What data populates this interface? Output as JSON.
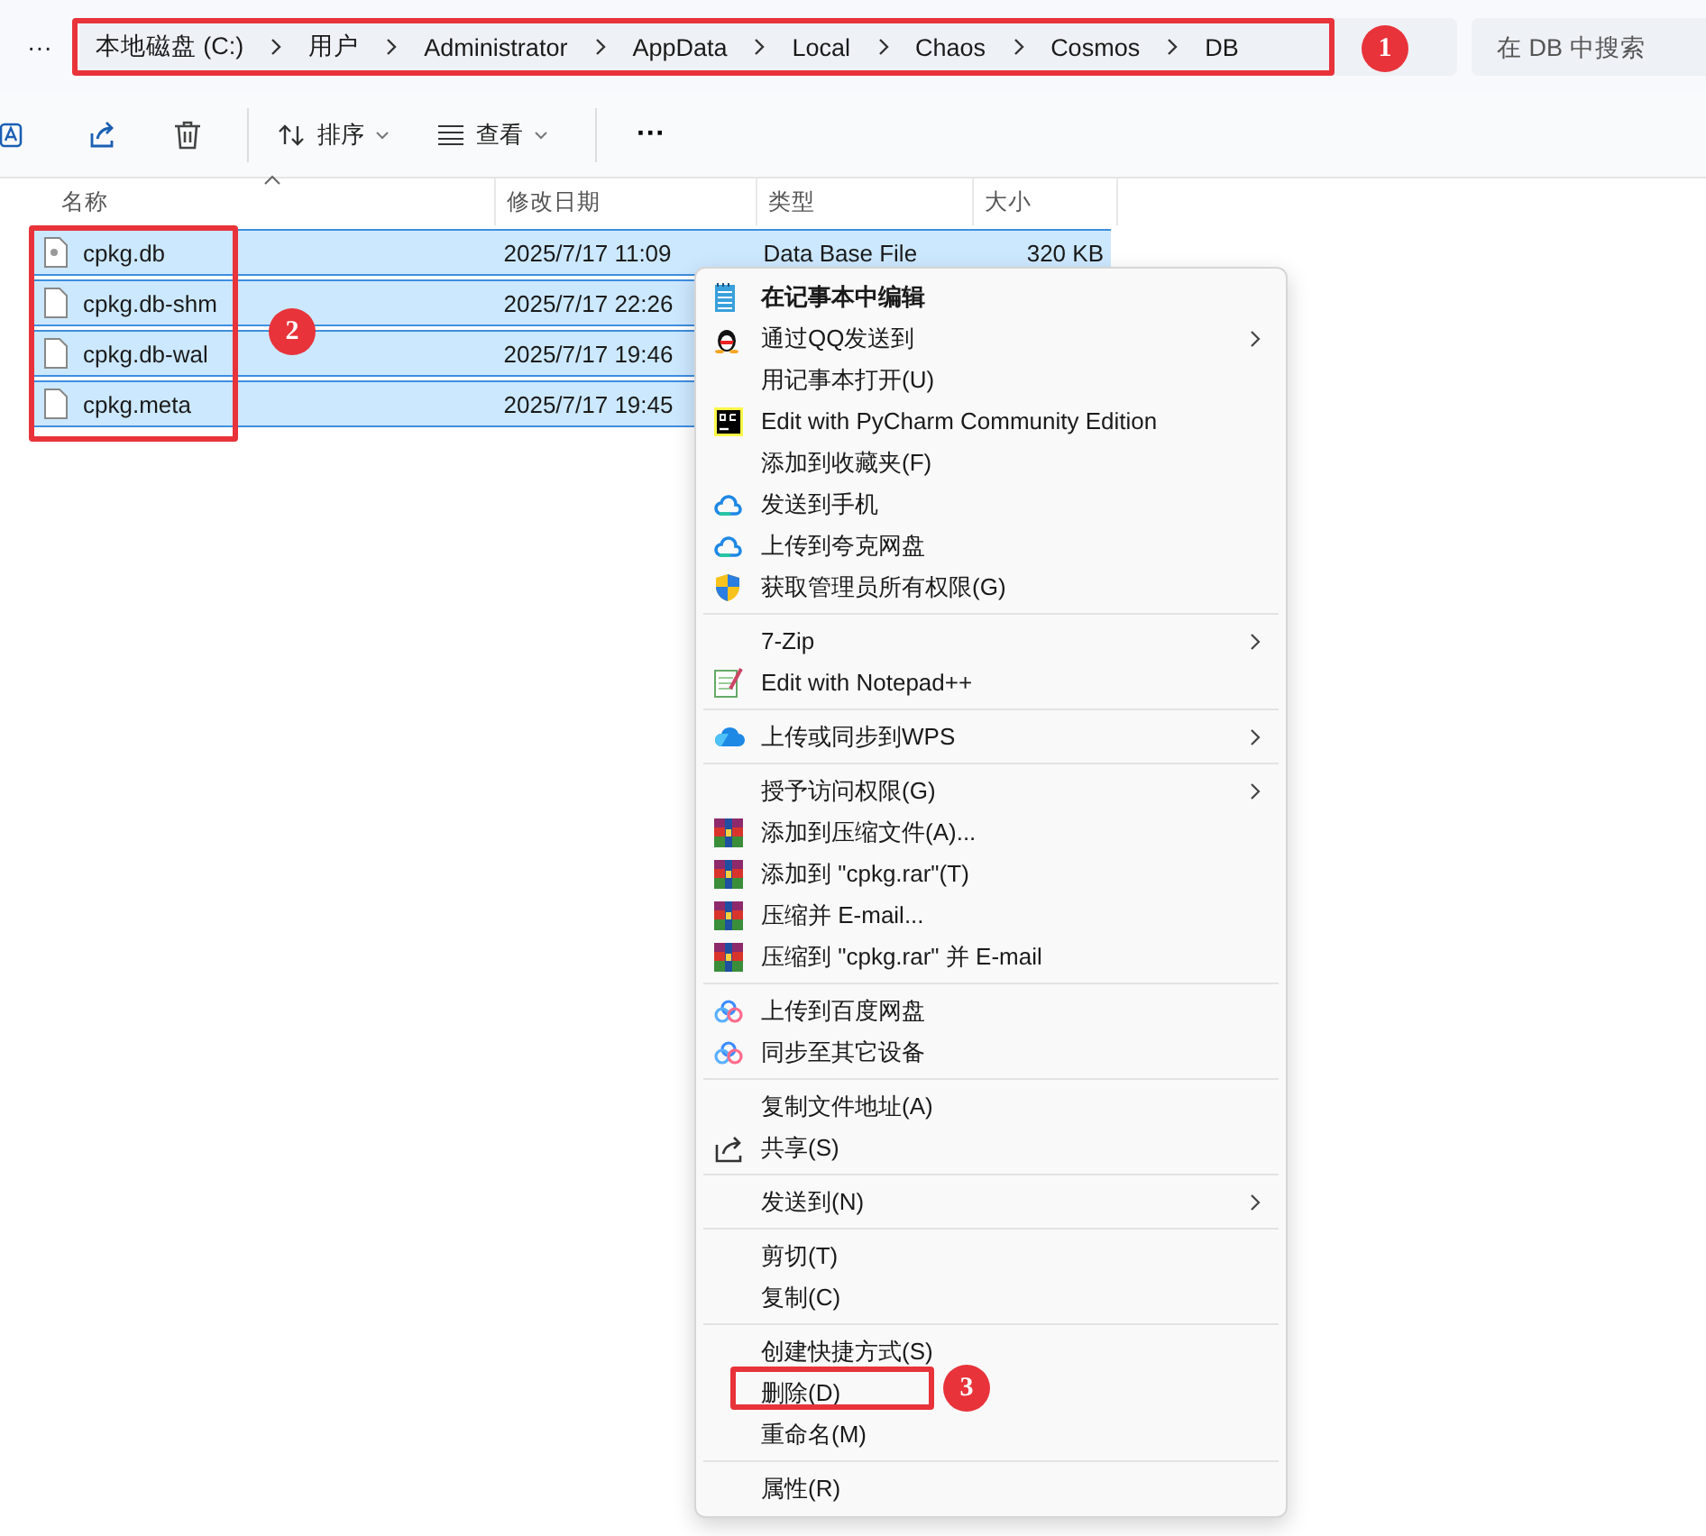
{
  "address_bar": {
    "more": "···",
    "breadcrumbs": [
      "本地磁盘 (C:)",
      "用户",
      "Administrator",
      "AppData",
      "Local",
      "Chaos",
      "Cosmos",
      "DB"
    ]
  },
  "search": {
    "placeholder": "在 DB 中搜索"
  },
  "toolbar": {
    "sort": "排序",
    "view": "查看",
    "more": "···"
  },
  "table": {
    "columns": [
      "名称",
      "修改日期",
      "类型",
      "大小"
    ],
    "rows": [
      {
        "name": "cpkg.db",
        "modified": "2025/7/17 11:09",
        "type": "Data Base File",
        "size": "320 KB",
        "selected": true
      },
      {
        "name": "cpkg.db-shm",
        "modified": "2025/7/17 22:26",
        "selected": true
      },
      {
        "name": "cpkg.db-wal",
        "modified": "2025/7/17 19:46",
        "selected": true
      },
      {
        "name": "cpkg.meta",
        "modified": "2025/7/17 19:45",
        "selected": true
      }
    ]
  },
  "context_menu": {
    "groups": [
      {
        "items": [
          {
            "label": "在记事本中编辑",
            "default": true,
            "submenu": false
          },
          {
            "label": "通过QQ发送到",
            "default": false,
            "submenu": true
          },
          {
            "label": "用记事本打开(U)",
            "default": false,
            "submenu": false
          },
          {
            "label": "Edit with PyCharm Community Edition",
            "default": false,
            "submenu": false
          },
          {
            "label": "添加到收藏夹(F)",
            "default": false,
            "submenu": false
          },
          {
            "label": "发送到手机",
            "default": false,
            "submenu": false
          },
          {
            "label": "上传到夸克网盘",
            "default": false,
            "submenu": false
          },
          {
            "label": "获取管理员所有权限(G)",
            "default": false,
            "submenu": false
          }
        ]
      },
      {
        "items": [
          {
            "label": "7-Zip",
            "default": false,
            "submenu": true
          },
          {
            "label": "Edit with Notepad++",
            "default": false,
            "submenu": false
          }
        ]
      },
      {
        "items": [
          {
            "label": "上传或同步到WPS",
            "default": false,
            "submenu": true
          }
        ]
      },
      {
        "items": [
          {
            "label": "授予访问权限(G)",
            "default": false,
            "submenu": true
          },
          {
            "label": "添加到压缩文件(A)...",
            "default": false,
            "submenu": false
          },
          {
            "label": "添加到 \"cpkg.rar\"(T)",
            "default": false,
            "submenu": false
          },
          {
            "label": "压缩并 E-mail...",
            "default": false,
            "submenu": false
          },
          {
            "label": "压缩到 \"cpkg.rar\" 并 E-mail",
            "default": false,
            "submenu": false
          }
        ]
      },
      {
        "items": [
          {
            "label": "上传到百度网盘",
            "default": false,
            "submenu": false
          },
          {
            "label": "同步至其它设备",
            "default": false,
            "submenu": false
          }
        ]
      },
      {
        "items": [
          {
            "label": "复制文件地址(A)",
            "default": false,
            "submenu": false
          },
          {
            "label": "共享(S)",
            "default": false,
            "submenu": false
          }
        ]
      },
      {
        "items": [
          {
            "label": "发送到(N)",
            "default": false,
            "submenu": true
          }
        ]
      },
      {
        "items": [
          {
            "label": "剪切(T)",
            "default": false,
            "submenu": false
          },
          {
            "label": "复制(C)",
            "default": false,
            "submenu": false
          }
        ]
      },
      {
        "items": [
          {
            "label": "创建快捷方式(S)",
            "default": false,
            "submenu": false
          },
          {
            "label": "删除(D)",
            "default": false,
            "submenu": false
          },
          {
            "label": "重命名(M)",
            "default": false,
            "submenu": false
          }
        ]
      },
      {
        "items": [
          {
            "label": "属性(R)",
            "default": false,
            "submenu": false
          }
        ]
      }
    ]
  },
  "annotations": [
    {
      "number": "1"
    },
    {
      "number": "2"
    },
    {
      "number": "3"
    }
  ]
}
